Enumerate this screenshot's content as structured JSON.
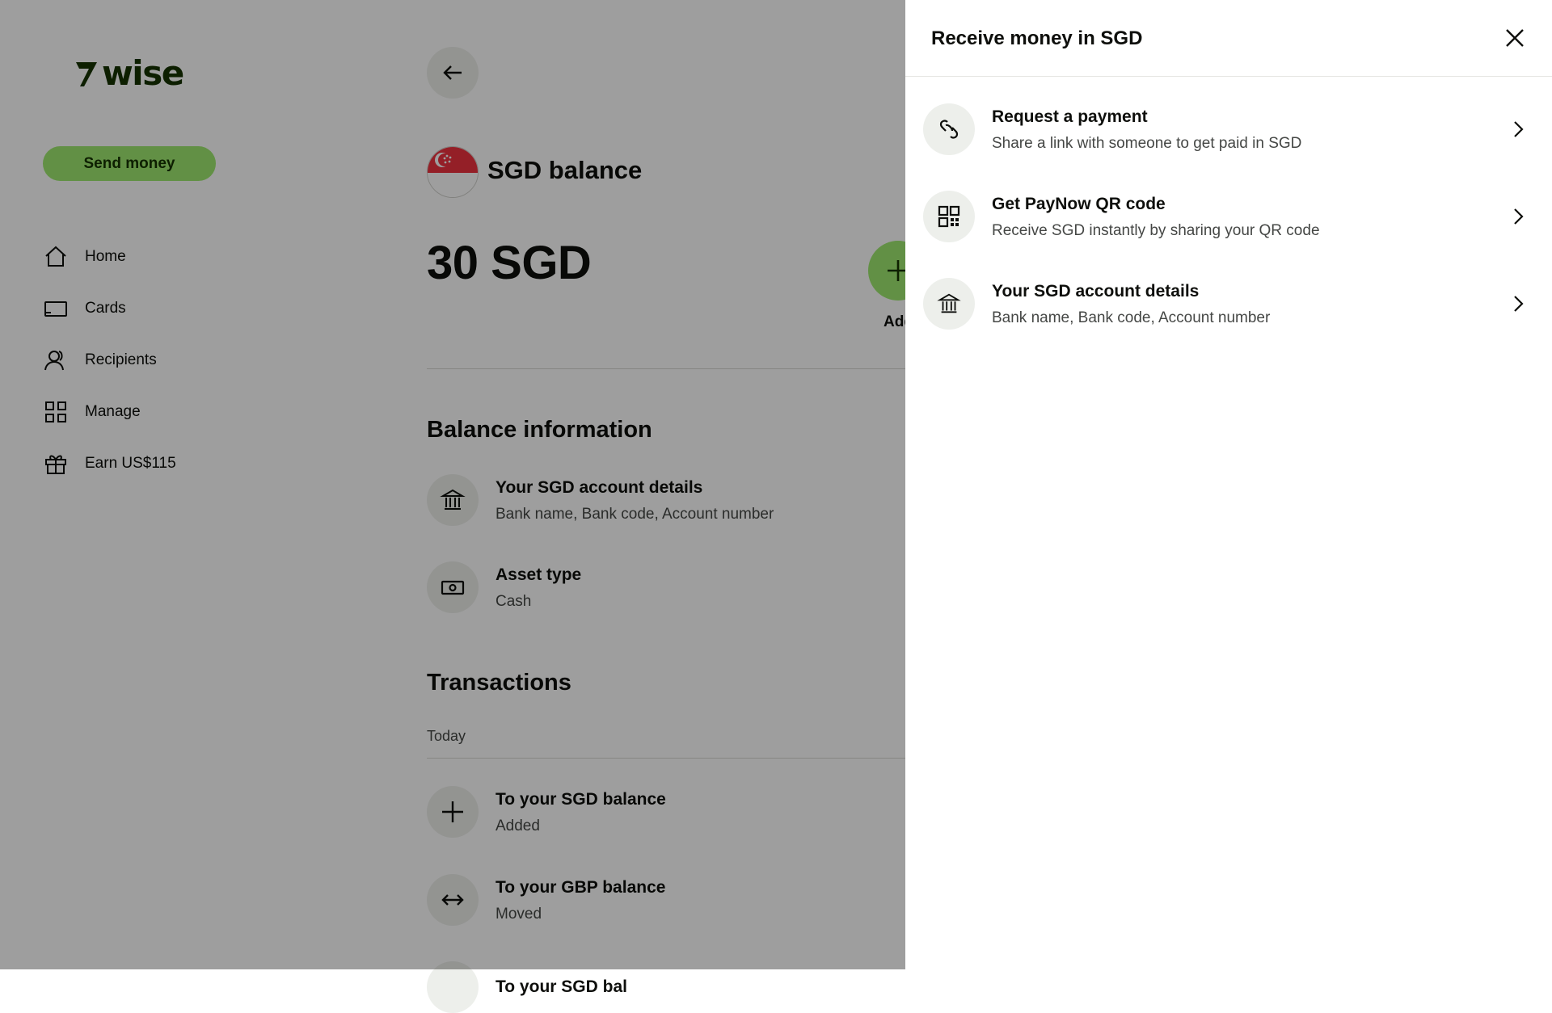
{
  "brand": {
    "name": "wise",
    "logo_color": "#163300",
    "accent": "#9fe870"
  },
  "sidebar": {
    "send_label": "Send money",
    "items": [
      {
        "label": "Home",
        "icon": "home-icon"
      },
      {
        "label": "Cards",
        "icon": "card-icon"
      },
      {
        "label": "Recipients",
        "icon": "recipients-icon"
      },
      {
        "label": "Manage",
        "icon": "grid-icon"
      },
      {
        "label": "Earn US$115",
        "icon": "gift-icon"
      }
    ]
  },
  "main": {
    "balance_title": "SGD balance",
    "amount": "30 SGD",
    "add_label": "Add",
    "balance_info": {
      "title": "Balance information",
      "items": [
        {
          "title": "Your SGD account details",
          "subtitle": "Bank name, Bank code, Account number",
          "icon": "bank-icon"
        },
        {
          "title": "Asset type",
          "subtitle": "Cash",
          "icon": "cash-icon"
        }
      ]
    },
    "transactions": {
      "title": "Transactions",
      "day": "Today",
      "items": [
        {
          "title": "To your SGD balance",
          "subtitle": "Added",
          "icon": "plus-icon"
        },
        {
          "title": "To your GBP balance",
          "subtitle": "Moved",
          "icon": "arrows-horizontal-icon"
        },
        {
          "title": "To your SGD bal",
          "subtitle": "",
          "icon": "plus-icon"
        }
      ]
    }
  },
  "drawer": {
    "title": "Receive money in SGD",
    "options": [
      {
        "title": "Request a payment",
        "subtitle": "Share a link with someone to get paid in SGD",
        "icon": "link-icon"
      },
      {
        "title": "Get PayNow QR code",
        "subtitle": "Receive SGD instantly by sharing your QR code",
        "icon": "qr-code-icon"
      },
      {
        "title": "Your SGD account details",
        "subtitle": "Bank name, Bank code, Account number",
        "icon": "bank-icon"
      }
    ]
  }
}
